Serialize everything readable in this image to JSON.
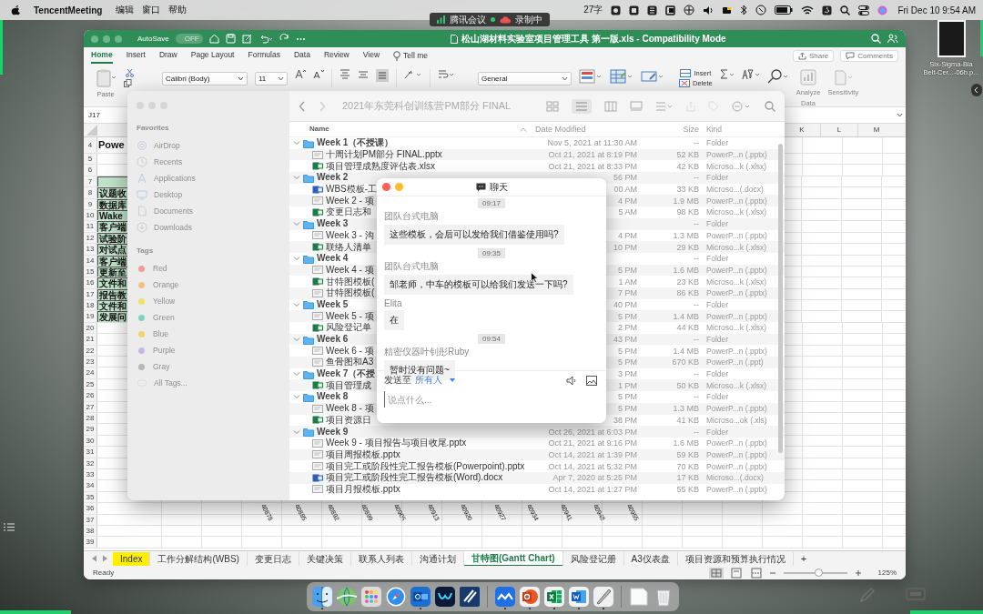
{
  "menu_bar": {
    "app": "TencentMeeting",
    "menus": [
      "编辑",
      "窗口",
      "帮助"
    ],
    "word_count": "27字",
    "clock": "Fri Dec 10  9:54 AM"
  },
  "meeting_indicator": {
    "app": "腾讯会议",
    "recording": "录制中"
  },
  "desktop_file": {
    "label_lines": [
      "Six-Sigma-Bla",
      "Belt-Cer...-06b.p..."
    ]
  },
  "excel": {
    "title": "松山湖材料实验室项目管理工具 第一版.xls - Compatibility Mode",
    "autosave": "AutoSave",
    "autosave_toggle": {
      "label": "OFF",
      "on": false
    },
    "ribbon_tabs": [
      {
        "label": "Home",
        "selected": true
      },
      {
        "label": "Insert",
        "selected": false
      },
      {
        "label": "Draw",
        "selected": false
      },
      {
        "label": "Page Layout",
        "selected": false
      },
      {
        "label": "Formulas",
        "selected": false
      },
      {
        "label": "Data",
        "selected": false
      },
      {
        "label": "Review",
        "selected": false
      },
      {
        "label": "View",
        "selected": false
      }
    ],
    "tell_me": "Tell me",
    "share": "Share",
    "comments": "Comments",
    "ribbon": {
      "paste": "Paste",
      "font_name": "Calibri (Body)",
      "font_size": "11",
      "number_format": "General",
      "insert": "Insert",
      "delete": "Delete",
      "analyze_data": [
        "Analyze",
        "Data"
      ],
      "sensitivity": "Sensitivity"
    },
    "name_box": "J17",
    "column_headers": [
      "K",
      "L",
      "M"
    ],
    "rows": [
      {
        "number": "4",
        "kind": "title",
        "cell": "Powe"
      },
      {
        "number": "5",
        "kind": "plain"
      },
      {
        "number": "6",
        "kind": "plain"
      },
      {
        "number": "7",
        "kind": "green"
      },
      {
        "number": "8",
        "kind": "green",
        "cell": "议题收"
      },
      {
        "number": "9",
        "kind": "green",
        "cell": "数据库"
      },
      {
        "number": "10",
        "kind": "green",
        "cell": "Wake"
      },
      {
        "number": "11",
        "kind": "green",
        "cell": "客户端"
      },
      {
        "number": "12",
        "kind": "green",
        "cell": "试验阶"
      },
      {
        "number": "13",
        "kind": "green",
        "cell": "对试点"
      },
      {
        "number": "14",
        "kind": "green",
        "cell": "客户端"
      },
      {
        "number": "15",
        "kind": "green",
        "cell": "更新至"
      },
      {
        "number": "16",
        "kind": "green",
        "cell": "文件和"
      },
      {
        "number": "17",
        "kind": "green",
        "cell": "报告教"
      },
      {
        "number": "18",
        "kind": "green",
        "cell": "文件和"
      },
      {
        "number": "19",
        "kind": "green",
        "cell": "发展问"
      },
      {
        "number": "20",
        "kind": "plain"
      },
      {
        "number": "21",
        "kind": "plain"
      },
      {
        "number": "22",
        "kind": "plain"
      },
      {
        "number": "23",
        "kind": "plain"
      },
      {
        "number": "24",
        "kind": "plain"
      },
      {
        "number": "25",
        "kind": "plain"
      },
      {
        "number": "26",
        "kind": "plain"
      },
      {
        "number": "27",
        "kind": "plain"
      },
      {
        "number": "28",
        "kind": "plain"
      },
      {
        "number": "29",
        "kind": "plain"
      },
      {
        "number": "30",
        "kind": "plain"
      },
      {
        "number": "31",
        "kind": "plain"
      },
      {
        "number": "32",
        "kind": "plain"
      },
      {
        "number": "33",
        "kind": "plain"
      },
      {
        "number": "34",
        "kind": "plain"
      },
      {
        "number": "35",
        "kind": "plain"
      },
      {
        "number": "36",
        "kind": "plain",
        "axis_labels": [
          "40878",
          "40885",
          "40892",
          "40899",
          "40906",
          "40913",
          "40920",
          "40927",
          "40934",
          "40941",
          "40948",
          "40955"
        ]
      },
      {
        "number": "37",
        "kind": "plain"
      },
      {
        "number": "38",
        "kind": "plain"
      },
      {
        "number": "39",
        "kind": "plain"
      }
    ],
    "sheet_tabs": [
      {
        "label": "Index",
        "selected": false,
        "color": "#ffef00"
      },
      {
        "label": "工作分解结构(WBS)",
        "selected": false
      },
      {
        "label": "变更日志",
        "selected": false
      },
      {
        "label": "关键决策",
        "selected": false
      },
      {
        "label": "联系人列表",
        "selected": false
      },
      {
        "label": "沟通计划",
        "selected": false
      },
      {
        "label": "甘特图(Gantt Chart)",
        "selected": true
      },
      {
        "label": "风险登记册",
        "selected": false
      },
      {
        "label": "A3仪表盘",
        "selected": false
      },
      {
        "label": "项目资源和预算执行情况",
        "selected": false
      }
    ],
    "add_sheet": "+",
    "status": "Ready",
    "zoom": {
      "level": 0.55,
      "reading": "125%"
    }
  },
  "finder": {
    "title": "2021年东莞科创训练营PM部分 FINAL",
    "favorites_heading": "Favorites",
    "favorites": [
      "AirDrop",
      "Recents",
      "Applications",
      "Desktop",
      "Documents",
      "Downloads"
    ],
    "tags_heading": "Tags",
    "tags": [
      {
        "label": "Red",
        "color": "#f29a9e"
      },
      {
        "label": "Orange",
        "color": "#f0c384"
      },
      {
        "label": "Yellow",
        "color": "#f1e06a"
      },
      {
        "label": "Green",
        "color": "#7fd3c2"
      },
      {
        "label": "Blue",
        "color": "#f1d56c"
      },
      {
        "label": "Purple",
        "color": "#c8b6e6"
      },
      {
        "label": "Gray",
        "color": "#b8b8b8"
      }
    ],
    "all_tags": "All Tags...",
    "columns": [
      "Name",
      "Date Modified",
      "Size",
      "Kind"
    ],
    "items": [
      {
        "kind": "folder",
        "name": "Week 1（不授课）",
        "date": "Nov 5, 2021 at 11:30 AM",
        "size": "--",
        "file_kind": "Folder",
        "expanded": true,
        "children": [
          {
            "kind": "pptx",
            "name": "十周计划PM部分 FINAL.pptx",
            "date": "Oct 21, 2021 at 8:19 PM",
            "size": "52 KB",
            "file_kind": "PowerP...n (.pptx)"
          },
          {
            "kind": "xlsx",
            "name": "项目管理成熟度评估表.xlsx",
            "date": "Oct 21, 2021 at 8:33 PM",
            "size": "42 KB",
            "file_kind": "Microso...k (.xlsx)"
          }
        ]
      },
      {
        "kind": "folder",
        "name": "Week 2",
        "date": "56 PM",
        "size": "--",
        "file_kind": "Folder",
        "expanded": true,
        "children": [
          {
            "kind": "docx",
            "name": "WBS模板-工",
            "date": "00 AM",
            "size": "33 KB",
            "file_kind": "Microso...(.docx)"
          },
          {
            "kind": "pptx",
            "name": "Week 2 - 项",
            "date": "4 PM",
            "size": "1.9 MB",
            "file_kind": "PowerP...n (.pptx)"
          },
          {
            "kind": "xlsx",
            "name": "变更日志和",
            "date": "5 AM",
            "size": "98 KB",
            "file_kind": "Microso...k (.xlsx)"
          }
        ]
      },
      {
        "kind": "folder",
        "name": "Week 3",
        "size": "--",
        "file_kind": "Folder",
        "expanded": true,
        "children": [
          {
            "kind": "pptx",
            "name": "Week 3 - 沟",
            "date": "4 PM",
            "size": "1.3 MB",
            "file_kind": "PowerP...n (.pptx)"
          },
          {
            "kind": "xlsx",
            "name": "联络人清单",
            "date": "10 PM",
            "size": "29 KB",
            "file_kind": "Microso...k (.xlsx)"
          }
        ]
      },
      {
        "kind": "folder",
        "name": "Week 4",
        "size": "--",
        "file_kind": "Folder",
        "expanded": true,
        "children": [
          {
            "kind": "pptx",
            "name": "Week 4 - 项",
            "date": "5 PM",
            "size": "1.6 MB",
            "file_kind": "PowerP...n (.pptx)"
          },
          {
            "kind": "xlsx",
            "name": "甘特图模板(",
            "date": "1 AM",
            "size": "23 KB",
            "file_kind": "Microso...k (.xlsx)"
          },
          {
            "kind": "pptx",
            "name": "甘特图模板(",
            "date": "7 PM",
            "size": "86 KB",
            "file_kind": "PowerP...n (.pptx)"
          }
        ]
      },
      {
        "kind": "folder",
        "name": "Week 5",
        "date": "40 PM",
        "size": "--",
        "file_kind": "Folder",
        "expanded": true,
        "children": [
          {
            "kind": "pptx",
            "name": "Week 5 - 项",
            "date": "5 PM",
            "size": "1.4 MB",
            "file_kind": "PowerP...n (.pptx)"
          },
          {
            "kind": "xlsx",
            "name": "风险登记单",
            "date": "2 PM",
            "size": "44 KB",
            "file_kind": "Microso...k (.xlsx)"
          }
        ]
      },
      {
        "kind": "folder",
        "name": "Week 6",
        "date": "43 PM",
        "size": "--",
        "file_kind": "Folder",
        "expanded": true,
        "children": [
          {
            "kind": "pptx",
            "name": "Week 6 - 项",
            "date": "5 PM",
            "size": "1.4 MB",
            "file_kind": "PowerP...n (.pptx)"
          },
          {
            "kind": "pptx",
            "name": "鱼骨图和A3",
            "date": "5 PM",
            "size": "670 KB",
            "file_kind": "PowerP...n (.ppt)"
          }
        ]
      },
      {
        "kind": "folder",
        "name": "Week 7（不授",
        "date": "3 PM",
        "size": "--",
        "file_kind": "Folder",
        "expanded": true,
        "children": [
          {
            "kind": "xlsx",
            "name": "项目管理成",
            "date": "1 PM",
            "size": "50 KB",
            "file_kind": "Microso...k (.xlsx)"
          }
        ]
      },
      {
        "kind": "folder",
        "name": "Week 8",
        "date": "5 PM",
        "size": "--",
        "file_kind": "Folder",
        "expanded": true,
        "children": [
          {
            "kind": "pptx",
            "name": "Week 8 - 项",
            "date": "5 PM",
            "size": "1.3 MB",
            "file_kind": "PowerP...n (.pptx)"
          },
          {
            "kind": "xlsx",
            "name": "项目资源日",
            "date": "38 PM",
            "size": "41 KB",
            "file_kind": "Microso...ok (.xls)"
          }
        ]
      },
      {
        "kind": "folder",
        "name": "Week 9",
        "date": "Oct 26, 2021 at 6:03 PM",
        "size": "--",
        "file_kind": "Folder",
        "expanded": true,
        "children": [
          {
            "kind": "pptx",
            "name": "Week 9 - 项目报告与项目收尾.pptx",
            "date": "Oct 21, 2021 at 9:16 PM",
            "size": "1.6 MB",
            "file_kind": "PowerP...n (.pptx)"
          },
          {
            "kind": "pptx",
            "name": "项目周报模板.pptx",
            "date": "Oct 14, 2021 at 1:39 PM",
            "size": "59 KB",
            "file_kind": "PowerP...n (.pptx)"
          },
          {
            "kind": "pptx",
            "name": "项目完工或阶段性完工报告模板(Powerpoint).pptx",
            "date": "Oct 14, 2021 at 5:32 PM",
            "size": "70 KB",
            "file_kind": "PowerP...n (.pptx)"
          },
          {
            "kind": "docx",
            "name": "项目完工或阶段性完工报告模板(Word).docx",
            "date": "Apr 7, 2020 at 5:25 PM",
            "size": "17 KB",
            "file_kind": "Microso...(.docx)"
          },
          {
            "kind": "pptx",
            "name": "项目月报模板.pptx",
            "date": "Oct 14, 2021 at 1:27 PM",
            "size": "55 KB",
            "file_kind": "PowerP...n (.pptx)"
          }
        ]
      }
    ]
  },
  "chat": {
    "title": "聊天",
    "messages": [
      {
        "kind": "time",
        "text": "09:17"
      },
      {
        "kind": "message",
        "sender": "团队台式电脑",
        "text": "这些模板，会后可以发给我们借鉴使用吗?"
      },
      {
        "kind": "time",
        "text": "09:35"
      },
      {
        "kind": "message",
        "sender": "团队台式电脑",
        "text": "邹老师，中车的模板可以给我们发送一下吗?"
      },
      {
        "kind": "message",
        "sender": "Elita",
        "text": "在"
      },
      {
        "kind": "time",
        "text": "09:54"
      },
      {
        "kind": "message",
        "sender": "精密仪器叶钊彤Ruby",
        "text": "暂时没有问题~"
      }
    ],
    "send_to": "发送至",
    "recipient": "所有人",
    "placeholder": "说点什么..."
  },
  "dock": {
    "apps": [
      {
        "kind": "finder",
        "running": true
      },
      {
        "kind": "globe",
        "running": false
      },
      {
        "kind": "launchpad",
        "running": false
      },
      {
        "kind": "compass",
        "running": false
      },
      {
        "kind": "mail",
        "running": true
      },
      {
        "kind": "loop",
        "running": false
      },
      {
        "kind": "slash",
        "running": false
      },
      {
        "kind": "separator"
      },
      {
        "kind": "meeting",
        "running": true
      },
      {
        "kind": "presentation",
        "running": true
      },
      {
        "kind": "spreadsheet",
        "running": true
      },
      {
        "kind": "document",
        "running": true
      },
      {
        "kind": "pen",
        "running": true
      },
      {
        "kind": "separator"
      },
      {
        "kind": "page",
        "running": false
      },
      {
        "kind": "trash",
        "running": false
      }
    ]
  }
}
